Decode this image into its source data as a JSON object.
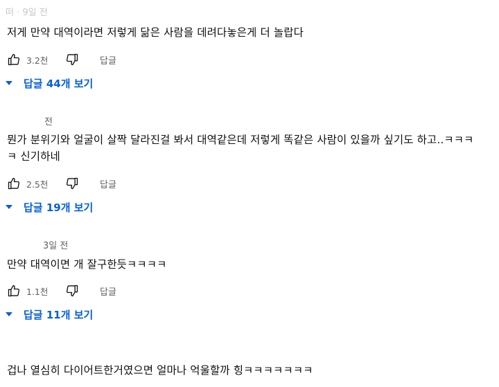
{
  "comments": [
    {
      "meta": "떠 · 9일 전",
      "text": "저게 만약 대역이라면 저렇게 닮은 사람을 데려다놓은게 더 놀랍다",
      "likes": "3.2천",
      "reply_label": "답글",
      "replies_label": "답글 44개 보기"
    },
    {
      "meta": "전",
      "text": "뭔가 분위기와 얼굴이 살짝 달라진걸 봐서 대역같은데 저렇게 똑같은 사람이 있을까 싶기도 하고..ㅋㅋㅋㅋ 신기하네",
      "likes": "2.5천",
      "reply_label": "답글",
      "replies_label": "답글 19개 보기"
    },
    {
      "meta": "3일 전",
      "text": "만약 대역이면 개 잘구한듯ㅋㅋㅋㅋ",
      "likes": "1.1천",
      "reply_label": "답글",
      "replies_label": "답글 11개 보기"
    },
    {
      "meta": "",
      "text": "겁나 열심히 다이어트한거였으면 얼마나 억울할까 힝ㅋㅋㅋㅋㅋㅋㅋ"
    }
  ]
}
